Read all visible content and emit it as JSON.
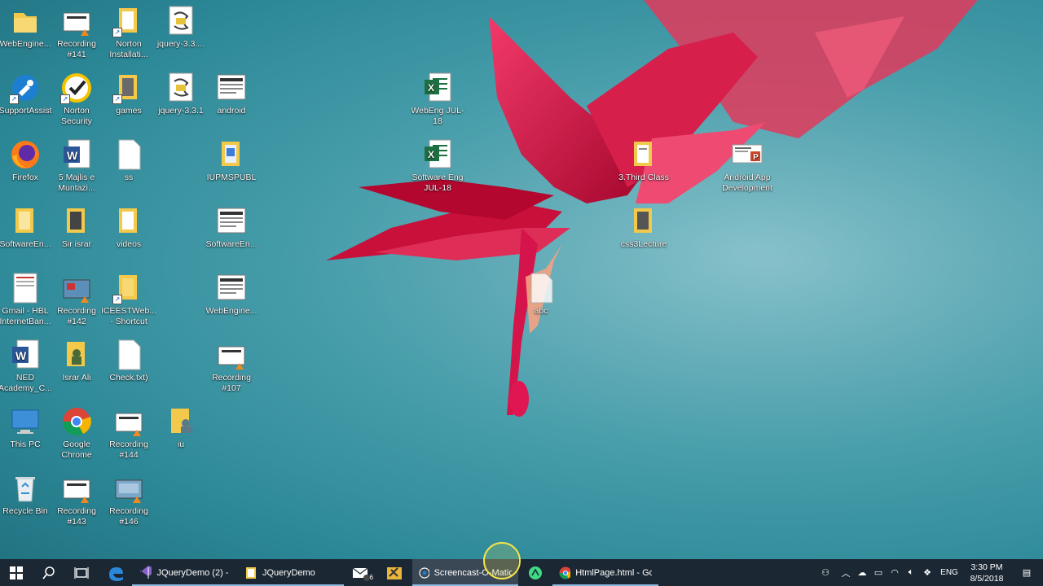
{
  "desktop": {
    "icons": [
      {
        "label": "WebEngine...",
        "kind": "folder-icon"
      },
      {
        "label": "Recording #141",
        "kind": "recording-icon"
      },
      {
        "label": "Norton Installati...",
        "kind": "folder-icon"
      },
      {
        "label": "jquery-3.3....",
        "kind": "script-icon"
      },
      {
        "label": "SupportAssist",
        "kind": "supportassist-icon"
      },
      {
        "label": "Norton Security",
        "kind": "norton-icon"
      },
      {
        "label": "games",
        "kind": "folder-icon"
      },
      {
        "label": "jquery-3.3.1",
        "kind": "script-icon"
      },
      {
        "label": "android",
        "kind": "document-thumb-icon"
      },
      {
        "label": "Firefox",
        "kind": "firefox-icon"
      },
      {
        "label": "5 Majlis e Muntazi...",
        "kind": "word-icon"
      },
      {
        "label": "ss",
        "kind": "blank-file-icon"
      },
      {
        "label": "IUPMSPUBL",
        "kind": "folder-icon"
      },
      {
        "label": "SoftwareEn...",
        "kind": "folder-icon"
      },
      {
        "label": "Sir israr",
        "kind": "folder-icon"
      },
      {
        "label": "videos",
        "kind": "folder-icon"
      },
      {
        "label": "SoftwareEn...",
        "kind": "document-thumb-icon"
      },
      {
        "label": "Gmail - HBL InternetBan...",
        "kind": "document-thumb-icon"
      },
      {
        "label": "Recording #142",
        "kind": "recording-icon"
      },
      {
        "label": "ICEESTWeb... - Shortcut",
        "kind": "folder-icon"
      },
      {
        "label": "WebEngine...",
        "kind": "document-thumb-icon"
      },
      {
        "label": "NED Academy_C...",
        "kind": "word-icon"
      },
      {
        "label": "Israr Ali",
        "kind": "folder-icon"
      },
      {
        "label": "Check.txt)",
        "kind": "blank-file-icon"
      },
      {
        "label": "Recording #107",
        "kind": "recording-icon"
      },
      {
        "label": "This PC",
        "kind": "this-pc-icon"
      },
      {
        "label": "Google Chrome",
        "kind": "chrome-icon"
      },
      {
        "label": "Recording #144",
        "kind": "recording-icon"
      },
      {
        "label": "iu",
        "kind": "folder-icon"
      },
      {
        "label": "Recycle Bin",
        "kind": "recycle-bin-icon"
      },
      {
        "label": "Recording #143",
        "kind": "recording-icon"
      },
      {
        "label": "Recording #146",
        "kind": "recording-icon"
      },
      {
        "label": "WebEng JUL-18",
        "kind": "excel-icon"
      },
      {
        "label": "Software Eng JUL-18",
        "kind": "excel-icon"
      },
      {
        "label": "3.Third Class",
        "kind": "folder-icon"
      },
      {
        "label": "css3Lecture",
        "kind": "folder-icon"
      },
      {
        "label": "abc",
        "kind": "blank-file-icon"
      },
      {
        "label": "Android App Development",
        "kind": "powerpoint-icon"
      }
    ]
  },
  "taskbar": {
    "apps": [
      {
        "label": "JQueryDemo (2) - ...",
        "icon": "visual-studio-icon",
        "color": "#8661c5"
      },
      {
        "label": "JQueryDemo",
        "icon": "folder-icon",
        "color": "#f3c94b"
      },
      {
        "label": "",
        "icon": "mail-icon",
        "color": "#ffffff",
        "badge": "6"
      },
      {
        "label": "",
        "icon": "tools-icon",
        "color": "#e9b53a"
      },
      {
        "label": "Screencast-O-Matic...",
        "icon": "screencast-icon",
        "color": "#ffffff"
      },
      {
        "label": "",
        "icon": "android-studio-icon",
        "color": "#3ddc84"
      },
      {
        "label": "HtmlPage.html - Go...",
        "icon": "chrome-icon",
        "color": "#db4437"
      }
    ],
    "tray": {
      "language": "ENG",
      "time": "3:30 PM",
      "date": "8/5/2018"
    }
  }
}
